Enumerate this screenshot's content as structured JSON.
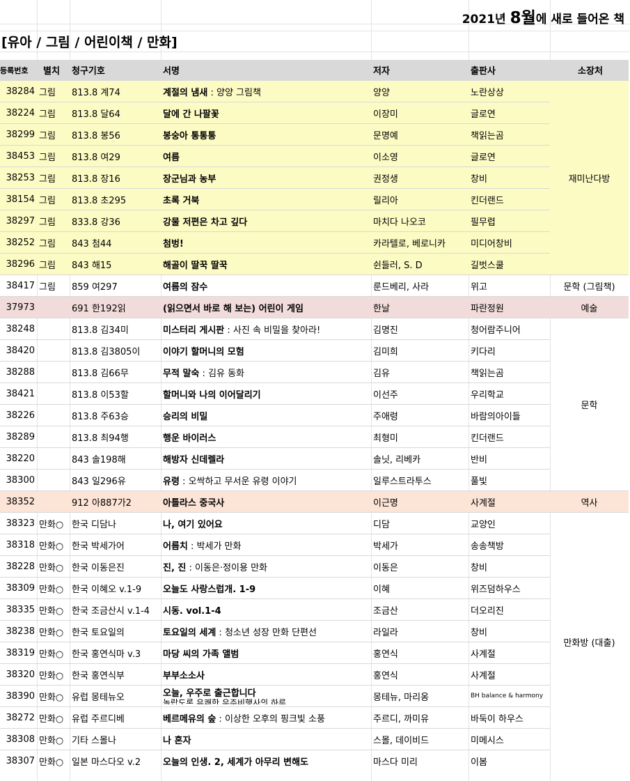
{
  "title": {
    "prefix": "2021년 ",
    "month": "8월",
    "suffix": "에 새로 들어온 책"
  },
  "section": "[유아 / 그림 / 어린이책 / 만화]",
  "headers": {
    "reg": "등록번호",
    "tag": "별치",
    "call": "청구기호",
    "title": "서명",
    "author": "저자",
    "publisher": "출판사",
    "location": "소장처"
  },
  "colors": {
    "header_bg": "#d9d9d9",
    "yellow": "#fdfbc4",
    "pink": "#f2dcdb",
    "peach": "#fce4d6"
  },
  "rows": [
    {
      "reg": "38284",
      "tag": "그림",
      "call": "813.8 계74",
      "title": "계절의 냄새",
      "sub": "양양 그림책",
      "author": "양양",
      "publisher": "노란상상"
    },
    {
      "reg": "38224",
      "tag": "그림",
      "call": "813.8 달64",
      "title": "달에 간 나팔꽃",
      "sub": "",
      "author": "이장미",
      "publisher": "글로연"
    },
    {
      "reg": "38299",
      "tag": "그림",
      "call": "813.8 봉56",
      "title": "봉숭아 통통통",
      "sub": "",
      "author": "문명예",
      "publisher": "책읽는곰"
    },
    {
      "reg": "38453",
      "tag": "그림",
      "call": "813.8 여29",
      "title": "여름",
      "sub": "",
      "author": "이소영",
      "publisher": "글로연"
    },
    {
      "reg": "38253",
      "tag": "그림",
      "call": "813.8 장16",
      "title": "장군님과 농부",
      "sub": "",
      "author": "권정생",
      "publisher": "창비"
    },
    {
      "reg": "38154",
      "tag": "그림",
      "call": "813.8 초295",
      "title": "초록 거북",
      "sub": "",
      "author": "릴리아",
      "publisher": "킨더랜드"
    },
    {
      "reg": "38297",
      "tag": "그림",
      "call": "833.8 강36",
      "title": "강물 저편은 차고 깊다",
      "sub": "",
      "author": "마치다 나오코",
      "publisher": "필무렵"
    },
    {
      "reg": "38252",
      "tag": "그림",
      "call": "843 첨44",
      "title": "첨벙!",
      "sub": "",
      "author": "카라텔로, 베로니카",
      "publisher": "미디어창비"
    },
    {
      "reg": "38296",
      "tag": "그림",
      "call": "843 해15",
      "title": "해골이 딸꾹 딸꾹",
      "sub": "",
      "author": "쉰들러, S. D",
      "publisher": "길벗스쿨"
    },
    {
      "reg": "38417",
      "tag": "그림",
      "call": "859 여297",
      "title": "여름의 잠수",
      "sub": "",
      "author": "룬드베리, 사라",
      "publisher": "위고"
    },
    {
      "reg": "37973",
      "tag": "",
      "call": "691 한192읽",
      "title": "(읽으면서 바로 해 보는) 어린이 게임",
      "sub": "",
      "author": "한날",
      "publisher": "파란정원"
    },
    {
      "reg": "38248",
      "tag": "",
      "call": "813.8 김34미",
      "title": "미스터리 게시판",
      "sub": "사진 속 비밀을 찾아라!",
      "author": "김명진",
      "publisher": "청어람주니어"
    },
    {
      "reg": "38420",
      "tag": "",
      "call": "813.8 김3805이",
      "title": "이야기 할머니의 모험",
      "sub": "",
      "author": "김미희",
      "publisher": "키다리"
    },
    {
      "reg": "38288",
      "tag": "",
      "call": "813.8 김66무",
      "title": "무적 말숙",
      "sub": "김유 동화",
      "author": "김유",
      "publisher": "책읽는곰"
    },
    {
      "reg": "38421",
      "tag": "",
      "call": "813.8 이53할",
      "title": "할머니와 나의 이어달리기",
      "sub": "",
      "author": "이선주",
      "publisher": "우리학교"
    },
    {
      "reg": "38226",
      "tag": "",
      "call": "813.8 주63승",
      "title": "승리의 비밀",
      "sub": "",
      "author": "주애령",
      "publisher": "바람의아이들"
    },
    {
      "reg": "38289",
      "tag": "",
      "call": "813.8 최94행",
      "title": "행운 바이러스",
      "sub": "",
      "author": "최형미",
      "publisher": "킨더랜드"
    },
    {
      "reg": "38220",
      "tag": "",
      "call": "843 솔198해",
      "title": "해방자 신데렐라",
      "sub": "",
      "author": "솔닛, 리베카",
      "publisher": "반비"
    },
    {
      "reg": "38300",
      "tag": "",
      "call": "843 일296유",
      "title": "유령",
      "sub": "오싹하고 무서운 유령 이야기",
      "author": "일루스트라투스",
      "publisher": "풀빛"
    },
    {
      "reg": "38352",
      "tag": "",
      "call": "912 아887가2",
      "title": "아틀라스 중국사",
      "sub": "",
      "author": "이근명",
      "publisher": "사계절"
    },
    {
      "reg": "38323",
      "tag": "만화○",
      "call": "한국 디담나",
      "title": "나, 여기 있어요",
      "sub": "",
      "author": "디담",
      "publisher": "교양인"
    },
    {
      "reg": "38318",
      "tag": "만화○",
      "call": "한국 박세가어",
      "title": "어름치",
      "sub": "박세가 만화",
      "author": "박세가",
      "publisher": "송송책방"
    },
    {
      "reg": "38228",
      "tag": "만화○",
      "call": "한국 이동은진",
      "title": "진, 진",
      "sub": "이동은·정이용 만화",
      "author": "이동은",
      "publisher": "창비"
    },
    {
      "reg": "38309",
      "tag": "만화○",
      "call": "한국 이혜오 v.1-9",
      "title": "오늘도 사랑스럽개. 1-9",
      "sub": "",
      "author": "이혜",
      "publisher": "위즈덤하우스"
    },
    {
      "reg": "38335",
      "tag": "만화○",
      "call": "한국 조금산시 v.1-4",
      "title": "시동. vol.1-4",
      "sub": "",
      "author": "조금산",
      "publisher": "더오리진"
    },
    {
      "reg": "38238",
      "tag": "만화○",
      "call": "한국 토요일의",
      "title": "토요일의 세계",
      "sub": "청소년 성장 만화 단편선",
      "author": "라일라",
      "publisher": "창비"
    },
    {
      "reg": "38319",
      "tag": "만화○",
      "call": "한국 홍연식마 v.3",
      "title": "마당 씨의 가족 앨범",
      "sub": "",
      "author": "홍연식",
      "publisher": "사계절"
    },
    {
      "reg": "38320",
      "tag": "만화○",
      "call": "한국 홍연식부",
      "title": "부부소소사",
      "sub": "",
      "author": "홍연식",
      "publisher": "사계절"
    },
    {
      "reg": "38390",
      "tag": "만화○",
      "call": "유럽 몽테뉴오",
      "title": "오늘, 우주로 출근합니다",
      "sub": "놀랍도록 유쾌한 우주비행사의 하루",
      "author": "몽테뉴, 마리옹",
      "publisher": "BH balance & harmony"
    },
    {
      "reg": "38272",
      "tag": "만화○",
      "call": "유럽 주르디베",
      "title": "베르메유의 숲",
      "sub": "이상한 오후의 핑크빛 소풍",
      "author": "주르디, 까미유",
      "publisher": "바둑이 하우스"
    },
    {
      "reg": "38308",
      "tag": "만화○",
      "call": "기타 스몰나",
      "title": "나 혼자",
      "sub": "",
      "author": "스몰, 데이비드",
      "publisher": "미메시스"
    },
    {
      "reg": "38307",
      "tag": "만화○",
      "call": "일본 마스다오 v.2",
      "title": "오늘의 인생. 2, 세계가 아무리 변해도",
      "sub": "",
      "author": "마스다 미리",
      "publisher": "이봄"
    }
  ],
  "locations": {
    "picture": "재미난다방",
    "lit_picture": "문학 (그림책)",
    "art": "예술",
    "lit": "문학",
    "history": "역사",
    "comics": "만화방 (대출)"
  }
}
